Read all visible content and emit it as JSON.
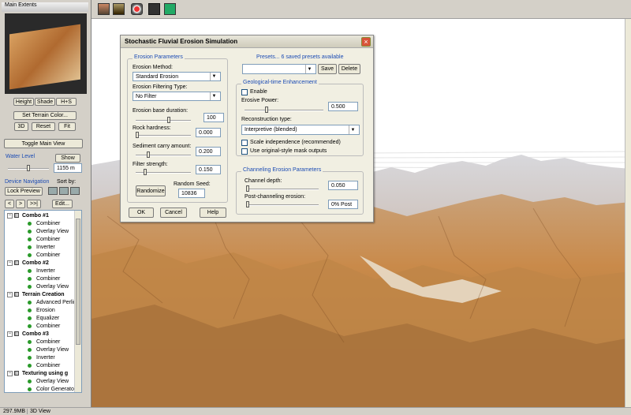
{
  "toolbar": {
    "icons": [
      "terrain-icon",
      "terrain-render-icon",
      "camera-icon",
      "lock-icon",
      "line-icon"
    ]
  },
  "left_panel": {
    "main_extents": "Main Extents",
    "height_btn": "Height",
    "shade_btn": "Shade",
    "hs_btn": "H+S",
    "set_terrain_color": "Set Terrain Color...",
    "btn_3d": "3D",
    "btn_reset": "Reset",
    "btn_fit": "Fit",
    "toggle_main_view": "Toggle Main View",
    "water_level": "Water Level",
    "show_btn": "Show",
    "water_value": "1155 m",
    "device_navigation": "Device Navigation",
    "sort_by": "Sort by:",
    "lock_preview": "Lock Preview",
    "nav_prev": "<",
    "nav_next": ">",
    "nav_last": ">>|",
    "edit_btn": "Edit..."
  },
  "tree": [
    {
      "type": "group",
      "label": "Combo #1"
    },
    {
      "type": "item",
      "label": "Combiner"
    },
    {
      "type": "item",
      "label": "Overlay View"
    },
    {
      "type": "item",
      "label": "Combiner"
    },
    {
      "type": "item",
      "label": "Inverter"
    },
    {
      "type": "item",
      "label": "Combiner"
    },
    {
      "type": "group",
      "label": "Combo #2"
    },
    {
      "type": "item",
      "label": "Inverter"
    },
    {
      "type": "item",
      "label": "Combiner"
    },
    {
      "type": "item",
      "label": "Overlay View"
    },
    {
      "type": "group",
      "label": "Terrain Creation"
    },
    {
      "type": "item",
      "label": "Advanced Perlin"
    },
    {
      "type": "item",
      "label": "Erosion"
    },
    {
      "type": "item",
      "label": "Equalizer"
    },
    {
      "type": "item",
      "label": "Combiner"
    },
    {
      "type": "group",
      "label": "Combo #3"
    },
    {
      "type": "item",
      "label": "Combiner"
    },
    {
      "type": "item",
      "label": "Overlay View"
    },
    {
      "type": "item",
      "label": "Inverter"
    },
    {
      "type": "item",
      "label": "Combiner"
    },
    {
      "type": "group",
      "label": "Texturing using g"
    },
    {
      "type": "item",
      "label": "Overlay View"
    },
    {
      "type": "item",
      "label": "Color Generator"
    }
  ],
  "status": {
    "memory": "297.9MB",
    "view": "3D View"
  },
  "dialog": {
    "title": "Stochastic Fluvial Erosion Simulation",
    "erosion_params_title": "Erosion Parameters",
    "erosion_method_label": "Erosion Method:",
    "erosion_method_value": "Standard Erosion",
    "filtering_type_label": "Erosion Filtering Type:",
    "filtering_type_value": "No Filter",
    "base_duration_label": "Erosion base duration:",
    "base_duration_value": "100",
    "rock_hardness_label": "Rock hardness:",
    "rock_hardness_value": "0.000",
    "sediment_label": "Sediment carry amount:",
    "sediment_value": "0.200",
    "filter_strength_label": "Filter strength:",
    "filter_strength_value": "0.150",
    "randomize_btn": "Randomize",
    "random_seed_label": "Random Seed:",
    "random_seed_value": "10836",
    "presets_label": "Presets... 6 saved presets available",
    "save_btn": "Save",
    "delete_btn": "Delete",
    "geo_title": "Geological-time Enhancement",
    "enable_label": "Enable",
    "erosive_power_label": "Erosive Power:",
    "erosive_power_value": "0.500",
    "reconstruction_label": "Reconstruction type:",
    "reconstruction_value": "Interpretive (blended)",
    "scale_label": "Scale independence (recommended)",
    "mask_label": "Use original-style mask outputs",
    "channel_title": "Channeling Erosion Parameters",
    "channel_depth_label": "Channel depth:",
    "channel_depth_value": "0.050",
    "post_channel_label": "Post-channeling erosion:",
    "post_channel_value": "0% Post",
    "ok_btn": "OK",
    "cancel_btn": "Cancel",
    "help_btn": "Help"
  },
  "colors": {
    "accent": "#1c4cb4",
    "dialog_bg": "#f1efe2",
    "titlebar": "#d8d4c4"
  }
}
